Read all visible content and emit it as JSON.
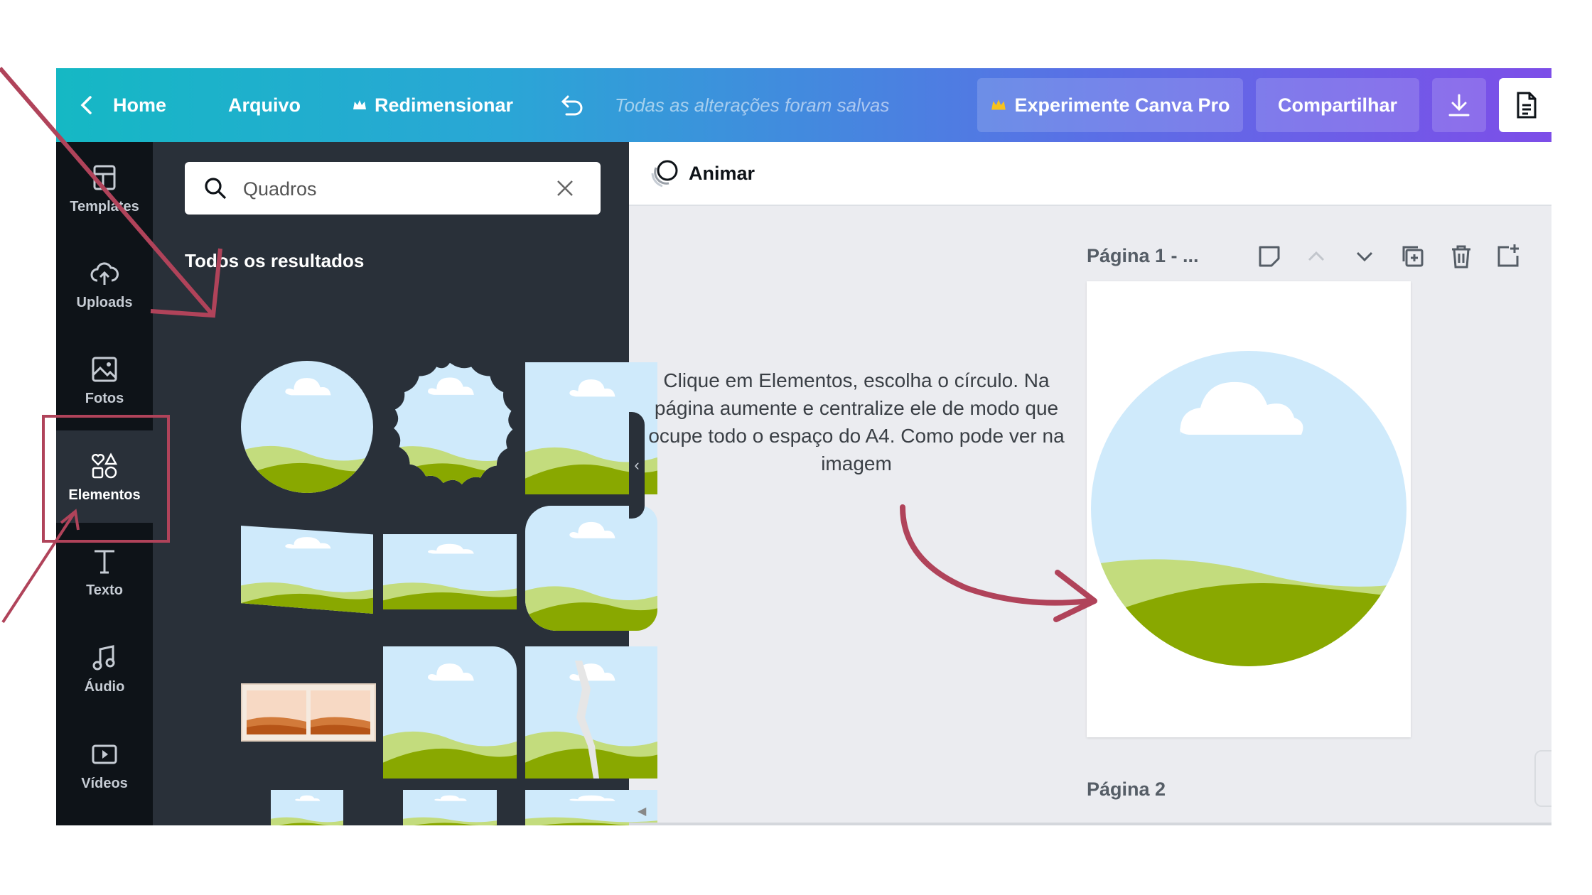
{
  "topbar": {
    "home": "Home",
    "file": "Arquivo",
    "resize": "Redimensionar",
    "saved_status": "Todas as alterações foram salvas",
    "try_pro": "Experimente Canva Pro",
    "share": "Compartilhar"
  },
  "rail": [
    {
      "label": "Templates",
      "icon": "templates-icon"
    },
    {
      "label": "Uploads",
      "icon": "upload-cloud-icon"
    },
    {
      "label": "Fotos",
      "icon": "photo-icon"
    },
    {
      "label": "Elementos",
      "icon": "shapes-icon",
      "active": true
    },
    {
      "label": "Texto",
      "icon": "text-icon"
    },
    {
      "label": "Áudio",
      "icon": "music-note-icon"
    },
    {
      "label": "Vídeos",
      "icon": "video-icon"
    }
  ],
  "panel": {
    "search_value": "Quadros",
    "results_title": "Todos os resultados"
  },
  "workspace": {
    "animate": "Animar",
    "page1_title": "Página 1 - ...",
    "page2_title": "Página 2"
  },
  "instruction": "Clique em Elementos, escolha o círculo. Na página aumente e centralize ele de modo que ocupe todo o espaço do A4. Como pode ver na imagem",
  "colors": {
    "annotation": "#b0435a",
    "sky": "#cfeafb",
    "hill_light": "#c3dc7d",
    "hill_dark": "#89a800",
    "rail_bg": "#0e1318",
    "panel_bg": "#293039"
  }
}
